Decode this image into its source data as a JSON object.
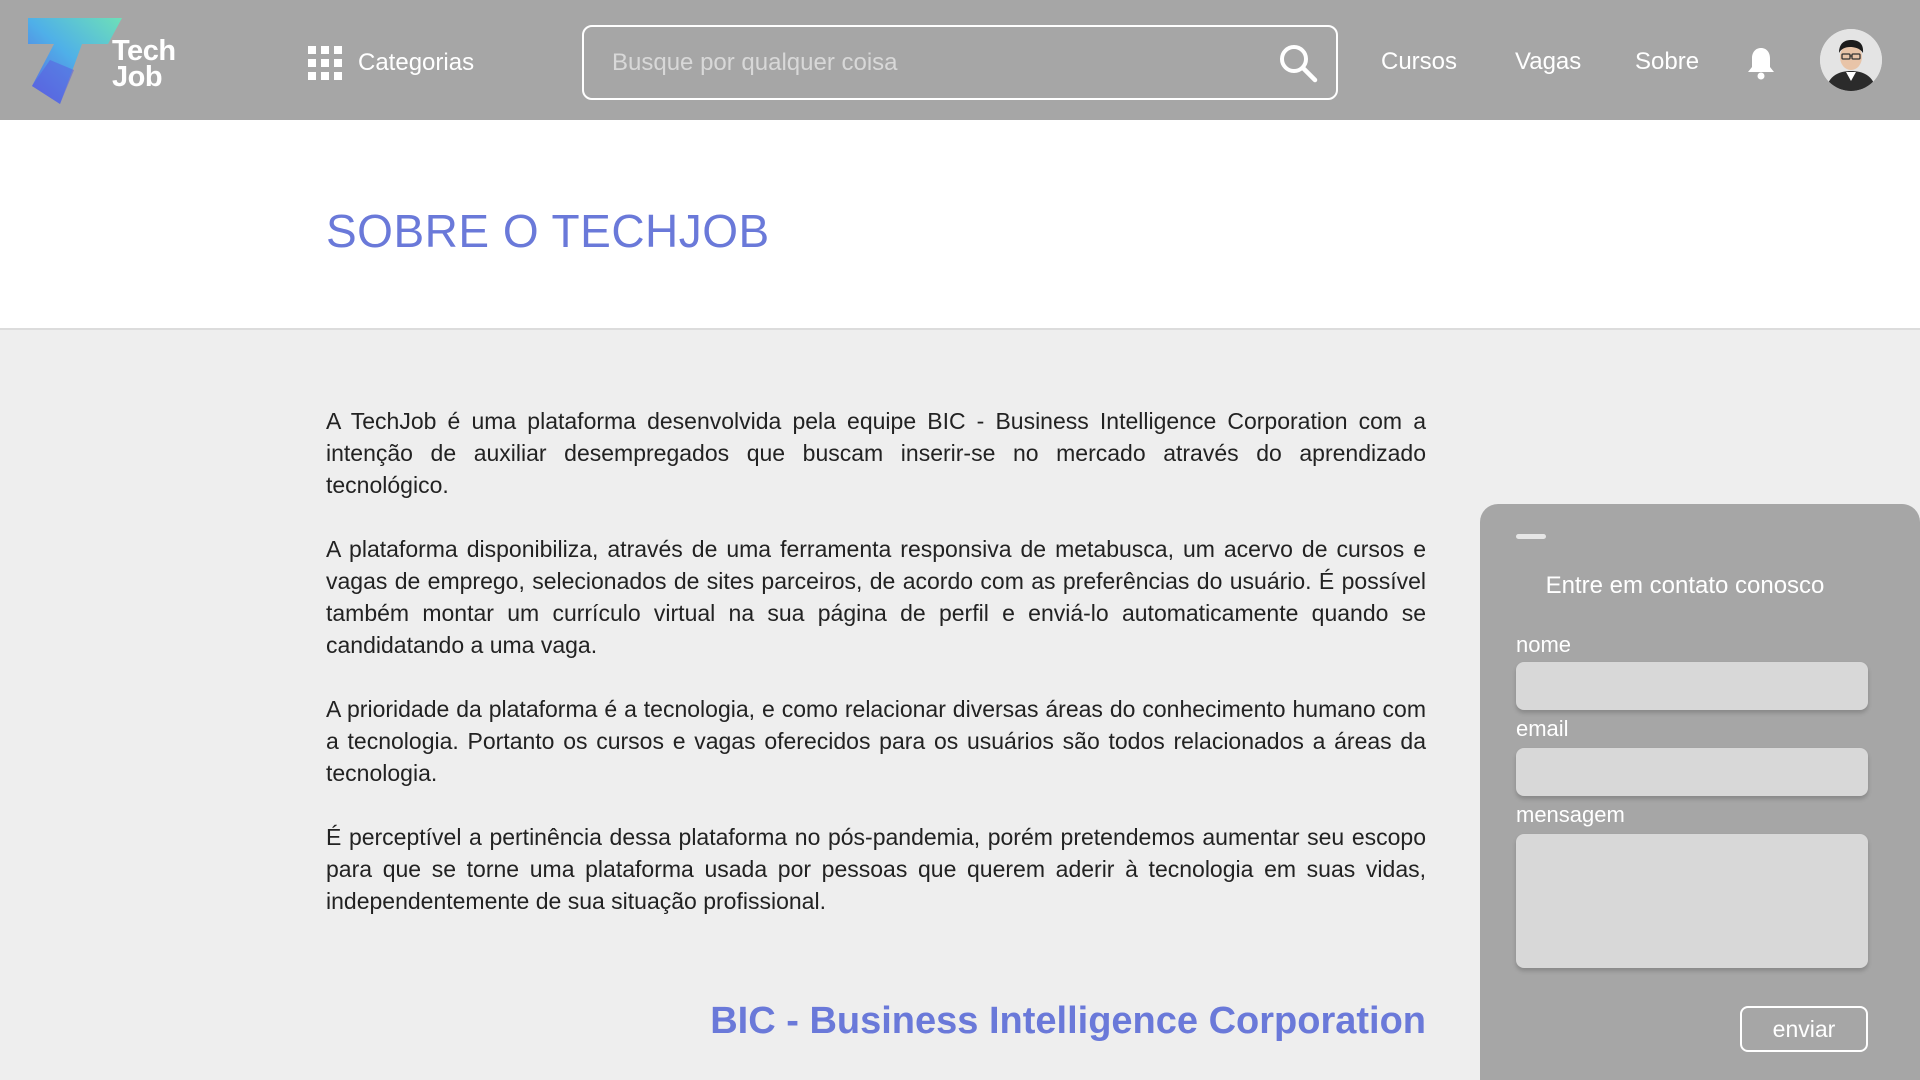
{
  "header": {
    "logo": {
      "line1": "Tech",
      "line2": "Job"
    },
    "categories_label": "Categorias",
    "search_placeholder": "Busque por qualquer coisa",
    "nav": [
      "Cursos",
      "Vagas",
      "Sobre"
    ],
    "icons": {
      "categories": "grid-icon",
      "search": "search-icon",
      "notifications": "bell-icon",
      "profile": "avatar"
    }
  },
  "page": {
    "title": "SOBRE O TECHJOB",
    "paragraphs": [
      "A TechJob é uma plataforma desenvolvida pela equipe BIC - Business Intelligence Corporation com a intenção de auxiliar desempregados que buscam inserir-se no mercado através do aprendizado tecnológico.",
      "A plataforma disponibiliza, através de uma ferramenta responsiva de metabusca, um acervo de cursos e vagas de emprego, selecionados de sites parceiros, de acordo com as preferências do usuário. É possível também montar um currículo virtual na sua página de perfil e enviá-lo automaticamente quando se candidatando a uma vaga.",
      "A prioridade da plataforma é a tecnologia, e como relacionar diversas áreas do conhecimento humano com a tecnologia. Portanto os cursos e vagas oferecidos para os usuários são todos relacionados a áreas da tecnologia.",
      "É perceptível a pertinência dessa plataforma no pós-pandemia, porém pretendemos aumentar seu escopo para que se torne uma plataforma usada por pessoas que querem aderir à tecnologia em suas vidas, independentemente de sua situação profissional."
    ],
    "company_heading": "BIC - Business Intelligence Corporation"
  },
  "contact": {
    "title": "Entre em contato conosco",
    "name_label": "nome",
    "email_label": "email",
    "message_label": "mensagem",
    "name_value": "",
    "email_value": "",
    "message_value": "",
    "submit_label": "enviar"
  },
  "colors": {
    "header_bg": "#a6a6a6",
    "accent": "#6a79d9",
    "page_bg": "#eeeeee"
  }
}
